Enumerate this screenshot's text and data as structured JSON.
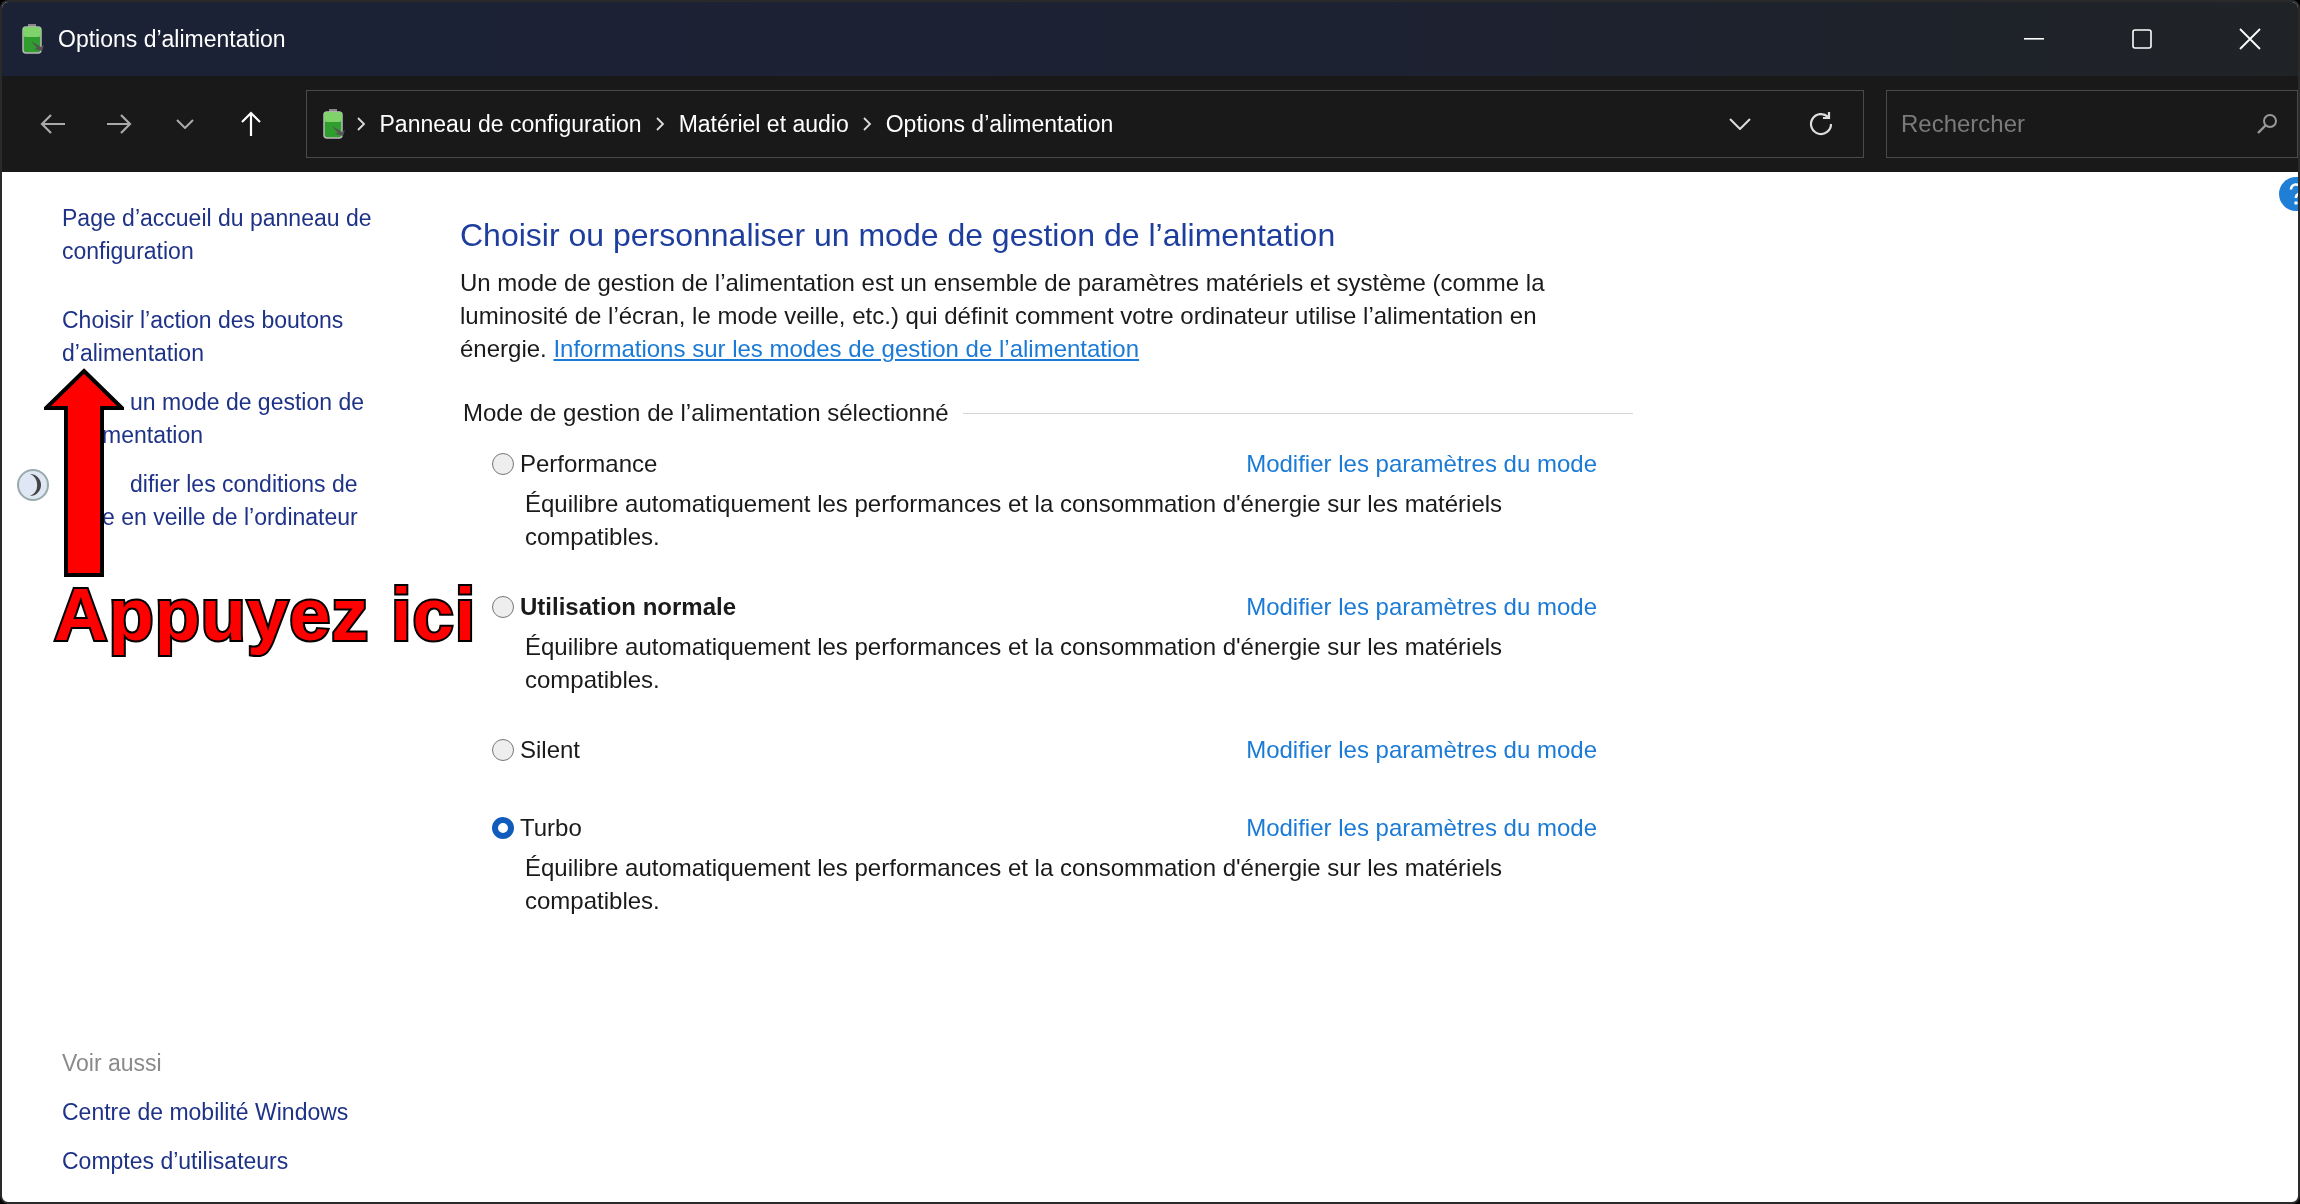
{
  "window": {
    "title": "Options d’alimentation"
  },
  "address_bar": {
    "breadcrumbs": [
      "Panneau de configuration",
      "Matériel et audio",
      "Options d’alimentation"
    ]
  },
  "search": {
    "placeholder": "Rechercher"
  },
  "sidebar": {
    "links": [
      {
        "lines": [
          "Page d’accueil du panneau de",
          "configuration"
        ],
        "covered": false,
        "icon": false
      },
      {
        "lines": [
          "Choisir l’action des boutons",
          "d’alimentation"
        ],
        "covered": false,
        "icon": false
      },
      {
        "lines": [
          "un mode de gestion de",
          "mentation"
        ],
        "covered": true,
        "icon": false
      },
      {
        "lines": [
          "difier les conditions de",
          "e en veille de l’ordinateur"
        ],
        "covered": true,
        "icon": true
      }
    ],
    "see_also_title": "Voir aussi",
    "see_also": [
      "Centre de mobilité Windows",
      "Comptes d’utilisateurs"
    ]
  },
  "main": {
    "title": "Choisir ou personnaliser un mode de gestion de l’alimentation",
    "intro": "Un mode de gestion de l’alimentation est un ensemble de paramètres matériels et système (comme la luminosité de l’écran, le mode veille, etc.) qui définit comment votre ordinateur utilise l’alimentation en énergie.",
    "intro_link": "Informations sur les modes de gestion de l’alimentation",
    "group_title": "Mode de gestion de l’alimentation sélectionné",
    "plans": [
      {
        "name": "Performance",
        "selected": false,
        "bold": false,
        "link": "Modifier les paramètres du mode",
        "description": "Équilibre automatiquement les performances et la consommation d'énergie sur les matériels compatibles."
      },
      {
        "name": "Utilisation normale",
        "selected": false,
        "bold": true,
        "link": "Modifier les paramètres du mode",
        "description": "Équilibre automatiquement les performances et la consommation d'énergie sur les matériels compatibles."
      },
      {
        "name": "Silent",
        "selected": false,
        "bold": false,
        "link": "Modifier les paramètres du mode"
      },
      {
        "name": "Turbo",
        "selected": true,
        "bold": false,
        "link": "Modifier les paramètres du mode",
        "description": "Équilibre automatiquement les performances et la consommation d'énergie sur les matériels compatibles."
      }
    ]
  },
  "annotation": {
    "text": "Appuyez ici"
  }
}
